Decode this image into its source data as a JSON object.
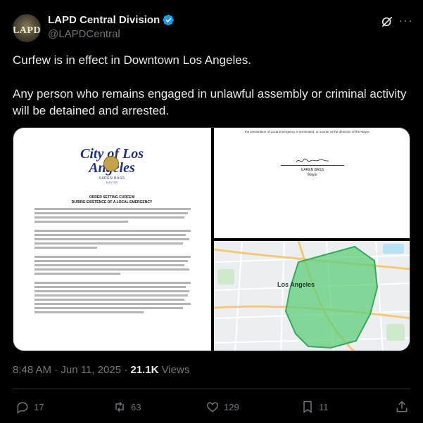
{
  "author": {
    "name": "LAPD Central Division",
    "handle": "@LAPDCentral",
    "avatar_text": "LAPD",
    "verified": true
  },
  "post": {
    "paragraphs": [
      "Curfew is in effect in Downtown Los Angeles.",
      "Any person who remains engaged in unlawful assembly or criminal activity will be detained and arrested."
    ]
  },
  "media": {
    "doc": {
      "city_title": "City of Los Angeles",
      "mayor_name": "KAREN BASS",
      "mayor_title": "MAYOR",
      "heading_1": "ORDER SETTING CURFEW",
      "heading_2": "DURING EXISTENCE OF A LOCAL EMERGENCY"
    },
    "page2": {
      "top_text": "the Declaration of Local Emergency is terminated, or sooner at the direction of the Mayor.",
      "sig_name": "KAREN BASS",
      "sig_title": "Mayor"
    },
    "map": {
      "city_label": "Los Angeles",
      "accent": "#5fcf7a"
    }
  },
  "meta": {
    "time": "8:48 AM",
    "separator": " · ",
    "date": "Jun 11, 2025",
    "views_count": "21.1K",
    "views_label": " Views"
  },
  "actions": {
    "replies": "17",
    "reposts": "63",
    "likes": "129",
    "bookmarks": "11"
  },
  "colors": {
    "background": "#000000",
    "text": "#e7e9ea",
    "muted": "#71767b",
    "verified": "#1d9bf0",
    "border": "#2f3336"
  }
}
